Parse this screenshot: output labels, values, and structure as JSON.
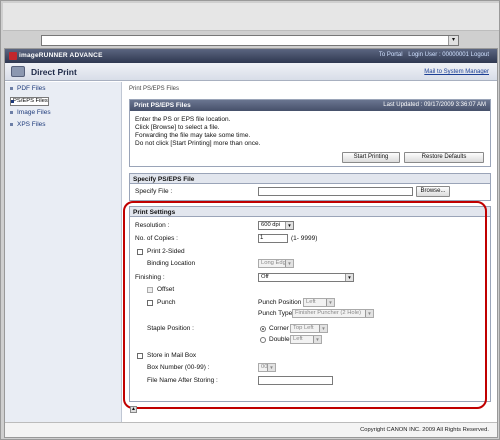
{
  "header": {
    "brand": "imageRUNNER ADVANCE",
    "links": [
      "To Portal",
      "Login User : 00000001 Logout"
    ],
    "page_title": "Direct Print",
    "mail_link": "Mail to System Manager"
  },
  "sidebar": {
    "items": [
      {
        "label": "PDF Files"
      },
      {
        "label": "PS/EPS Files"
      },
      {
        "label": "Image Files"
      },
      {
        "label": "XPS Files"
      }
    ]
  },
  "breadcrumb": "Print PS/EPS Files",
  "panel": {
    "title": "Print PS/EPS Files",
    "updated": "Last Updated : 09/17/2009 3:36:07 AM",
    "instructions": [
      "Enter the PS or EPS file location.",
      "Click [Browse] to select a file.",
      "Forwarding the file may take some time.",
      "Do not click [Start Printing] more than once."
    ],
    "start_btn": "Start Printing",
    "restore_btn": "Restore Defaults"
  },
  "specify": {
    "header": "Specify PS/EPS File",
    "label": "Specify File :",
    "value": "",
    "browse_btn": "Browse..."
  },
  "settings": {
    "header": "Print Settings",
    "resolution_label": "Resolution :",
    "resolution_value": "600 dpi",
    "copies_label": "No. of Copies :",
    "copies_value": "1",
    "copies_range": "(1- 9999)",
    "two_sided_label": "Print 2-Sided",
    "binding_label": "Binding Location",
    "binding_value": "Long Edge",
    "finishing_label": "Finishing :",
    "finishing_value": "Off",
    "offset_label": "Offset",
    "punch_label": "Punch",
    "punch_position_label": "Punch Position",
    "punch_position_value": "Left",
    "punch_type_label": "Punch Type",
    "punch_type_value": "Finisher Puncher (2 Hole)",
    "staple_label": "Staple Position :",
    "corner_label": "Corner",
    "corner_value": "Top Left",
    "double_label": "Double",
    "double_value": "Left",
    "mailbox_label": "Store in Mail Box",
    "box_number_label": "Box Number (00-99) :",
    "box_number_value": "00",
    "filename_label": "File Name After Storing :",
    "filename_value": ""
  },
  "footer": "Copyright CANON INC. 2009 All Rights Reserved."
}
